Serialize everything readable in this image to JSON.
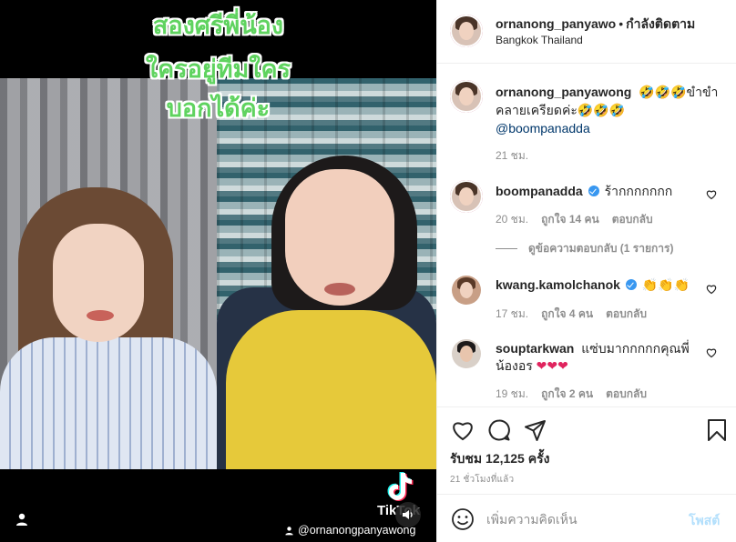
{
  "video": {
    "caption_lines": [
      "สองศรีพี่น้อง",
      "ใครอยู่ทีมใคร",
      "บอกได้ค่ะ"
    ],
    "tiktok_logo_text": "TikTok",
    "tiktok_handle": "@ornanongpanyawong",
    "icons": [
      "user-tag-icon",
      "tiktok-logo",
      "speaker-icon"
    ]
  },
  "post_header": {
    "username": "ornanong_panyawo",
    "separator": "•",
    "follow_label": "กำลังติดตาม",
    "location": "Bangkok Thailand"
  },
  "caption": {
    "username": "ornanong_panyawong",
    "text_emoji": "🤣🤣🤣",
    "text_part1": "ขำขำ",
    "text_part2": "คลายเครียดค่ะ",
    "text_emoji2": "🤣🤣🤣",
    "mention": "@boompanadda",
    "time": "21 ชม."
  },
  "comments": [
    {
      "username": "boompanadda",
      "verified": true,
      "text": "ร้ากกกกกกก",
      "time": "20 ชม.",
      "likes": "ถูกใจ 14 คน",
      "reply": "ตอบกลับ",
      "view_replies": "ดูข้อความตอบกลับ (1 รายการ)"
    },
    {
      "username": "kwang.kamolchanok",
      "verified": true,
      "text": "👏👏👏",
      "time": "17 ชม.",
      "likes": "ถูกใจ 4 คน",
      "reply": "ตอบกลับ"
    },
    {
      "username": "souptarkwan",
      "verified": false,
      "text": "แซ่บมากกกกกคุณพี่",
      "text2": "น้องอร",
      "hearts": "❤❤❤",
      "time": "19 ชม.",
      "likes": "ถูกใจ 2 คน",
      "reply": "ตอบกลับ"
    }
  ],
  "actions": {
    "likes_text": "รับชม 12,125 ครั้ง",
    "time_ago": "21 ชั่วโมงที่แล้ว",
    "icons": [
      "heart-icon",
      "comment-icon",
      "share-icon",
      "bookmark-icon"
    ]
  },
  "add_comment": {
    "placeholder": "เพิ่มความคิดเห็น",
    "post_label": "โพสต์"
  },
  "colors": {
    "caption_green": "#5fd35f",
    "link": "#00376b",
    "verified": "#3897f0",
    "muted": "#8e8e8e",
    "post_disabled": "#b2dffc"
  }
}
